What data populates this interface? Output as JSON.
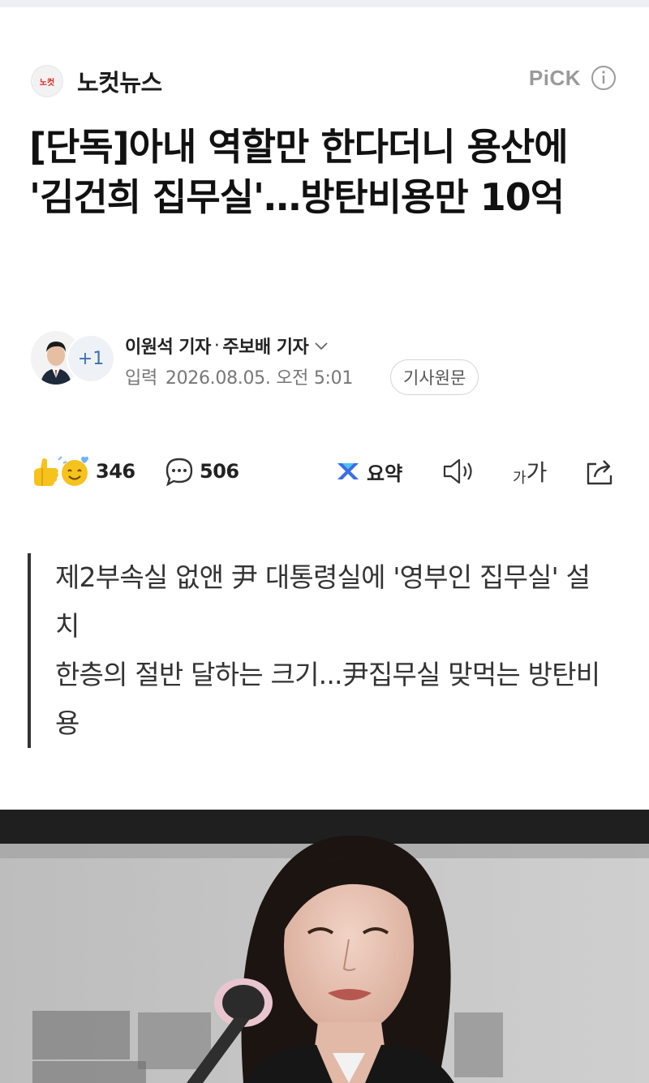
{
  "publisher": {
    "logo_text": "노컷",
    "name": "노컷뉴스",
    "pick_label": "PiCK"
  },
  "article": {
    "title": "[단독]아내 역할만 한다더니 용산에 '김건희 집무실'…방탄비용만 10억",
    "reporters": [
      "이원석 기자",
      "주보배 기자"
    ],
    "reporter_separator": "·",
    "more_reporters": "+1",
    "date_label": "입력",
    "date": "2026.08.05. 오전 5:01",
    "original_button": "기사원문",
    "summary_lines": [
      "제2부속실 없앤 尹 대통령실에 '영부인 집무실' 설치",
      "한층의 절반 달하는 크기...尹집무실 맞먹는 방탄비용"
    ]
  },
  "actions": {
    "reaction_count": "346",
    "comment_count": "506",
    "summary_label": "요약",
    "font_size_label_small": "가",
    "font_size_label_large": "가"
  },
  "icons": {
    "info": "info-circle-icon",
    "chevron": "chevron-down-icon",
    "reaction": "reaction-emoji-icon",
    "comment": "comment-bubble-icon",
    "summary": "ai-summary-icon",
    "speaker": "speaker-icon",
    "font_size": "font-size-icon",
    "share": "share-icon"
  },
  "colors": {
    "brand_red": "#d9251d",
    "summary_icon_blue": "#3a6ee8",
    "text_primary": "#111111",
    "text_secondary": "#777777"
  }
}
